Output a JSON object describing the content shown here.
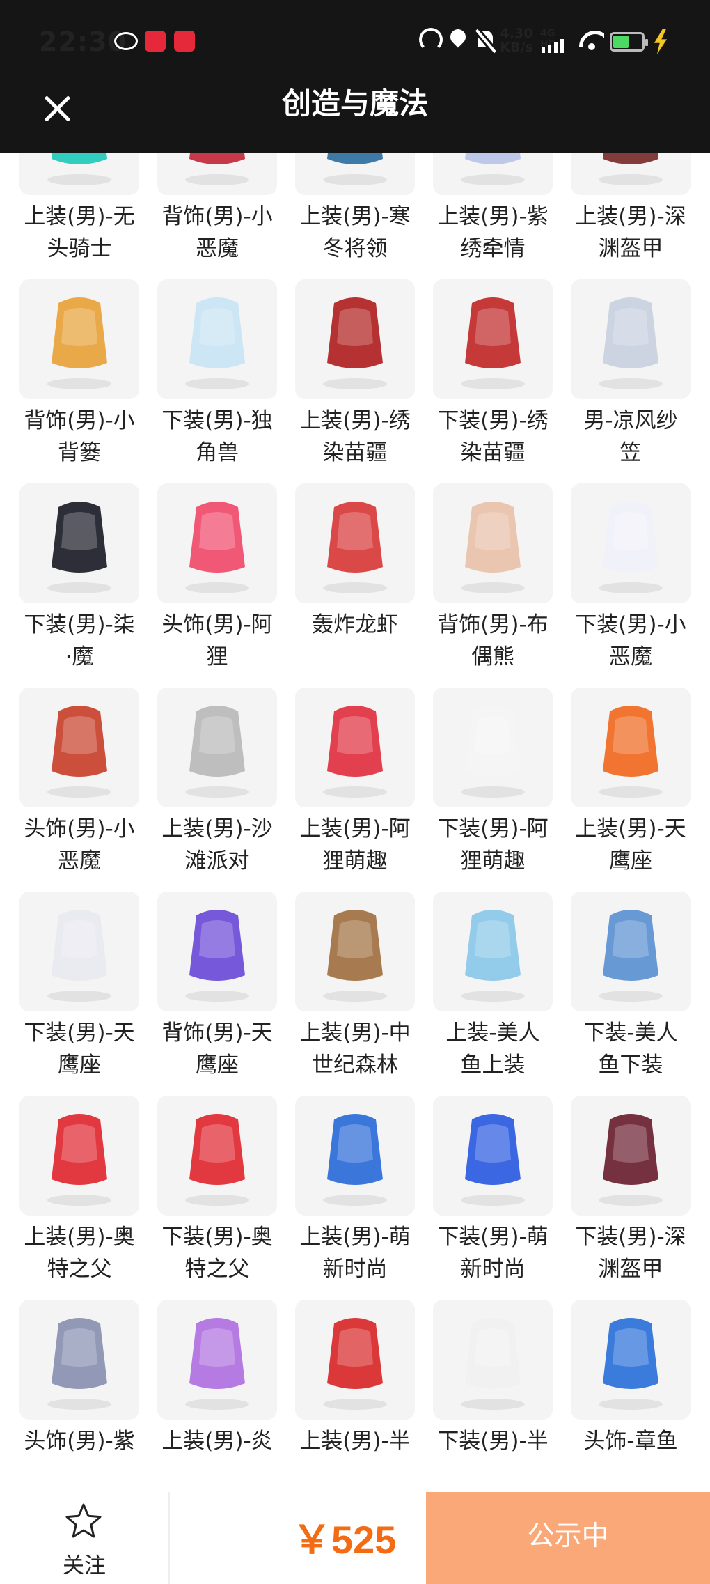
{
  "status_bar": {
    "time": "22:30",
    "net_speed_value": "4.30",
    "net_speed_unit": "KB/s",
    "network_label": "4G HD",
    "battery_level": 0.55,
    "icons": [
      "wechat-icon",
      "app-icon",
      "app-icon",
      "speed-icon",
      "location-icon",
      "mute-icon",
      "signal-icon",
      "wifi-icon",
      "battery-icon",
      "charging-icon"
    ]
  },
  "header": {
    "title": "创造与魔法",
    "close_icon": "close-icon"
  },
  "items": [
    {
      "name": "上装(男)-无头骑士",
      "line1": "上装(男)-无",
      "line2": "头骑士",
      "color": "#1fc9b8"
    },
    {
      "name": "背饰(男)-小恶魔",
      "line1": "背饰(男)-小",
      "line2": "恶魔",
      "color": "#c0283a"
    },
    {
      "name": "上装(男)-寒冬将领",
      "line1": "上装(男)-寒",
      "line2": "冬将领",
      "color": "#2e6fa0"
    },
    {
      "name": "上装(男)-紫绣牵情",
      "line1": "上装(男)-紫",
      "line2": "绣牵情",
      "color": "#b8c4e8"
    },
    {
      "name": "上装(男)-深渊盔甲",
      "line1": "上装(男)-深",
      "line2": "渊盔甲",
      "color": "#7a2a2a"
    },
    {
      "name": "背饰(男)-小背篓",
      "line1": "背饰(男)-小",
      "line2": "背篓",
      "color": "#e8a23a"
    },
    {
      "name": "下装(男)-独角兽",
      "line1": "下装(男)-独",
      "line2": "角兽",
      "color": "#c8e4f4"
    },
    {
      "name": "上装(男)-绣染苗疆",
      "line1": "上装(男)-绣",
      "line2": "染苗疆",
      "color": "#b02020"
    },
    {
      "name": "下装(男)-绣染苗疆",
      "line1": "下装(男)-绣",
      "line2": "染苗疆",
      "color": "#c02828"
    },
    {
      "name": "男-凉风纱笠",
      "line1": "男-凉风纱",
      "line2": "笠",
      "color": "#c8d0e0"
    },
    {
      "name": "下装(男)-柒·魔",
      "line1": "下装(男)-柒",
      "line2": "·魔",
      "color": "#1c1c28"
    },
    {
      "name": "头饰(男)-阿狸",
      "line1": "头饰(男)-阿",
      "line2": "狸",
      "color": "#f04a6a"
    },
    {
      "name": "轰炸龙虾",
      "line1": "轰炸龙虾",
      "line2": "",
      "color": "#d83838"
    },
    {
      "name": "背饰(男)-布偶熊",
      "line1": "背饰(男)-布",
      "line2": "偶熊",
      "color": "#e8c0a8"
    },
    {
      "name": "下装(男)-小恶魔",
      "line1": "下装(男)-小",
      "line2": "恶魔",
      "color": "#f0f0f8"
    },
    {
      "name": "头饰(男)-小恶魔",
      "line1": "头饰(男)-小",
      "line2": "恶魔",
      "color": "#c8402a"
    },
    {
      "name": "上装(男)-沙滩派对",
      "line1": "上装(男)-沙",
      "line2": "滩派对",
      "color": "#b8b8b8"
    },
    {
      "name": "上装(男)-阿狸萌趣",
      "line1": "上装(男)-阿",
      "line2": "狸萌趣",
      "color": "#e03040"
    },
    {
      "name": "下装(男)-阿狸萌趣",
      "line1": "下装(男)-阿",
      "line2": "狸萌趣",
      "color": "#f4f4f4"
    },
    {
      "name": "上装(男)-天鹰座",
      "line1": "上装(男)-天",
      "line2": "鹰座",
      "color": "#f06820"
    },
    {
      "name": "下装(男)-天鹰座",
      "line1": "下装(男)-天",
      "line2": "鹰座",
      "color": "#e8e8f0"
    },
    {
      "name": "背饰(男)-天鹰座",
      "line1": "背饰(男)-天",
      "line2": "鹰座",
      "color": "#6a4ad8"
    },
    {
      "name": "上装(男)-中世纪森林",
      "line1": "上装(男)-中",
      "line2": "世纪森林",
      "color": "#a07040"
    },
    {
      "name": "上装-美人鱼上装",
      "line1": "上装-美人",
      "line2": "鱼上装",
      "color": "#8ac8e8"
    },
    {
      "name": "下装-美人鱼下装",
      "line1": "下装-美人",
      "line2": "鱼下装",
      "color": "#5a90d0"
    },
    {
      "name": "上装(男)-奥特之父",
      "line1": "上装(男)-奥",
      "line2": "特之父",
      "color": "#e02830"
    },
    {
      "name": "下装(男)-奥特之父",
      "line1": "下装(男)-奥",
      "line2": "特之父",
      "color": "#e02830"
    },
    {
      "name": "上装(男)-萌新时尚",
      "line1": "上装(男)-萌",
      "line2": "新时尚",
      "color": "#2a6ad8"
    },
    {
      "name": "下装(男)-萌新时尚",
      "line1": "下装(男)-萌",
      "line2": "新时尚",
      "color": "#2a5ae0"
    },
    {
      "name": "下装(男)-深渊盔甲",
      "line1": "下装(男)-深",
      "line2": "渊盔甲",
      "color": "#6a2030"
    },
    {
      "name": "头饰(男)-紫…",
      "line1": "头饰(男)-紫",
      "line2": "",
      "color": "#8890b0"
    },
    {
      "name": "上装(男)-炎…",
      "line1": "上装(男)-炎",
      "line2": "",
      "color": "#b070e0"
    },
    {
      "name": "上装(男)-半…",
      "line1": "上装(男)-半",
      "line2": "",
      "color": "#d82828"
    },
    {
      "name": "下装(男)-半…",
      "line1": "下装(男)-半",
      "line2": "",
      "color": "#f0f0f0"
    },
    {
      "name": "头饰-章鱼…",
      "line1": "头饰-章鱼",
      "line2": "",
      "color": "#2a70d8"
    }
  ],
  "bottom_bar": {
    "follow_label": "关注",
    "price": "￥525",
    "status_label": "公示中",
    "accent": "#f36c13",
    "button_color": "#fba878"
  }
}
